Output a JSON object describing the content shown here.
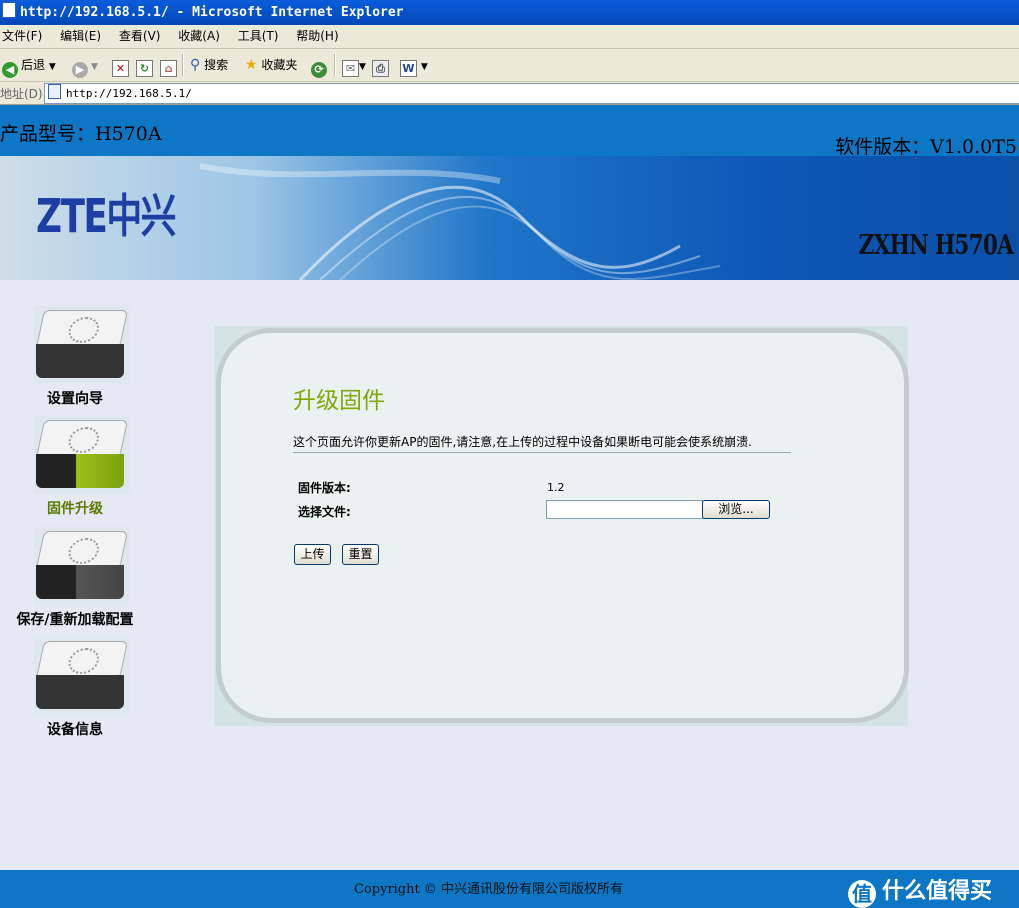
{
  "window": {
    "title": "http://192.168.5.1/ - Microsoft Internet Explorer"
  },
  "menu": [
    "文件(F)",
    "编辑(E)",
    "查看(V)",
    "收藏(A)",
    "工具(T)",
    "帮助(H)"
  ],
  "toolbar": {
    "back": "后退",
    "search": "搜索",
    "favorites": "收藏夹"
  },
  "address": {
    "label": "地址(D)",
    "url": "http://192.168.5.1/"
  },
  "header": {
    "model_label": "产品型号：H570A",
    "version_label": "软件版本：V1.0.0T5",
    "logo": "ZTE中兴",
    "banner_model": "ZXHN H570A"
  },
  "sidebar": {
    "items": [
      {
        "label": "设置向导",
        "active": false
      },
      {
        "label": "固件升级",
        "active": true
      },
      {
        "label": "保存/重新加载配置",
        "active": false
      },
      {
        "label": "设备信息",
        "active": false
      }
    ]
  },
  "main": {
    "title": "升级固件",
    "description": "这个页面允许你更新AP的固件,请注意,在上传的过程中设备如果断电可能会使系统崩溃.",
    "firmware_version_label": "固件版本:",
    "firmware_version_value": "1.2",
    "choose_file_label": "选择文件:",
    "file_value": "",
    "browse_label": "浏览...",
    "upload_label": "上传",
    "reset_label": "重置"
  },
  "footer": {
    "copyright": "Copyright © 中兴通讯股份有限公司版权所有",
    "watermark": "什么值得买",
    "watermark_icon": "值"
  },
  "colors": {
    "header_blue": "#0d76c5",
    "title_green": "#7fa90a",
    "page_bg": "#e6e9f3"
  }
}
